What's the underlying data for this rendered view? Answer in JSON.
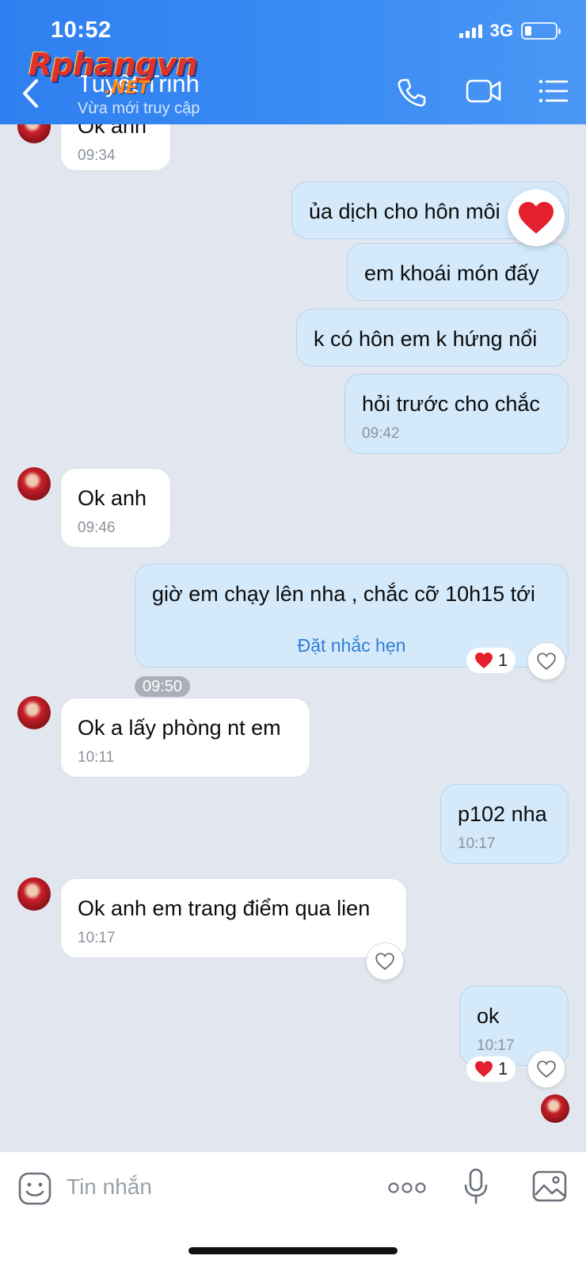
{
  "status_bar": {
    "time": "10:52",
    "network": "3G"
  },
  "header": {
    "contact_name": "Tuyết Trinh",
    "contact_status": "Vừa mới truy cập",
    "icons": [
      "back-icon",
      "phone-icon",
      "video-icon",
      "menu-icon"
    ]
  },
  "watermark": {
    "text": "Rphangvn",
    "sub": ".NET"
  },
  "messages": [
    {
      "side": "in",
      "text": "Ok anh",
      "time": "09:34"
    },
    {
      "side": "out",
      "text": "ủa dịch cho hôn môi",
      "reaction": "heart"
    },
    {
      "side": "out",
      "text": "em khoái món đấy"
    },
    {
      "side": "out",
      "text": "k có hôn em k hứng nổi"
    },
    {
      "side": "out",
      "text": "hỏi trước cho chắc",
      "time": "09:42"
    },
    {
      "side": "in",
      "text": "Ok anh",
      "time": "09:46"
    },
    {
      "side": "out",
      "text": "giờ em chạy lên nha , chắc cỡ 10h15 tới",
      "action": "Đặt nhắc hẹn",
      "time": "09:50",
      "reaction_count": "1"
    },
    {
      "side": "in",
      "text": "Ok a lấy phòng nt em",
      "time": "10:11"
    },
    {
      "side": "out",
      "text": "p102 nha",
      "time": "10:17"
    },
    {
      "side": "in",
      "text": "Ok anh em trang điểm qua lien",
      "time": "10:17"
    },
    {
      "side": "out",
      "text": "ok",
      "time": "10:17",
      "reaction_count": "1"
    }
  ],
  "input": {
    "placeholder": "Tin nhắn"
  },
  "colors": {
    "header": "#2f7ff0",
    "outgoing_bubble": "#d4eafb",
    "incoming_bubble": "#ffffff",
    "background": "#e2e6ee",
    "link": "#2f7cd9",
    "heart": "#e4202f"
  }
}
